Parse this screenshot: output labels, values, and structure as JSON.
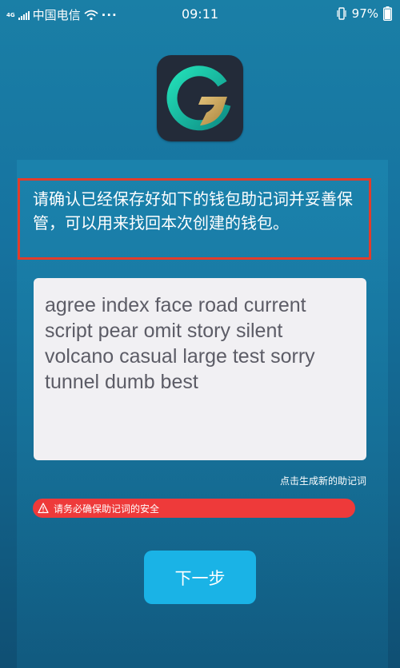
{
  "status_bar": {
    "network": "4G",
    "carrier": "中国电信",
    "dots": "···",
    "time": "09:11",
    "battery": "97%"
  },
  "notice": {
    "text": "请确认已经保存好如下的钱包助记词并妥善保管，可以用来找回本次创建的钱包。"
  },
  "mnemonic": {
    "words": "agree index face road current script pear omit story silent volcano casual large test sorry tunnel dumb best"
  },
  "regenerate_link": "点击生成新的助记词",
  "warning": {
    "text": "请务必确保助记词的安全"
  },
  "next_button": "下一步",
  "colors": {
    "accent": "#1ab3e6",
    "warning": "#ee3a3a",
    "border_red": "#e23c2b"
  }
}
